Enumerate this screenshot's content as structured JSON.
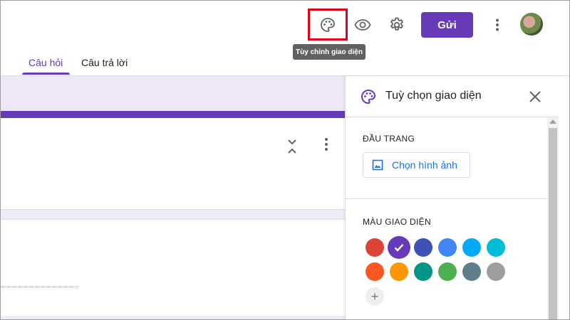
{
  "header": {
    "send_label": "Gửi",
    "tooltip": "Tùy chỉnh giao diện",
    "icons": [
      "palette-icon",
      "eye-icon",
      "gear-icon",
      "more-vert-icon"
    ]
  },
  "tabs": [
    {
      "label": "Câu hỏi",
      "active": true
    },
    {
      "label": "Câu trả lời",
      "active": false
    }
  ],
  "panel": {
    "title": "Tuỳ chọn giao diện",
    "header_section_label": "ĐẦU TRANG",
    "choose_image_label": "Chọn hình ảnh",
    "theme_section_label": "MÀU GIAO DIỆN",
    "add_label": "+",
    "selected_color": "#673ab7"
  },
  "colors": {
    "accent": "#673ab7",
    "link": "#1a73e8",
    "swatches_row1": [
      "#db4437",
      "#673ab7",
      "#3f51b5",
      "#4285f4",
      "#03a9f4",
      "#00bcd4"
    ],
    "swatches_row2": [
      "#ff5722",
      "#ff9800",
      "#009688",
      "#4caf50",
      "#607d8b",
      "#9e9e9e"
    ]
  }
}
